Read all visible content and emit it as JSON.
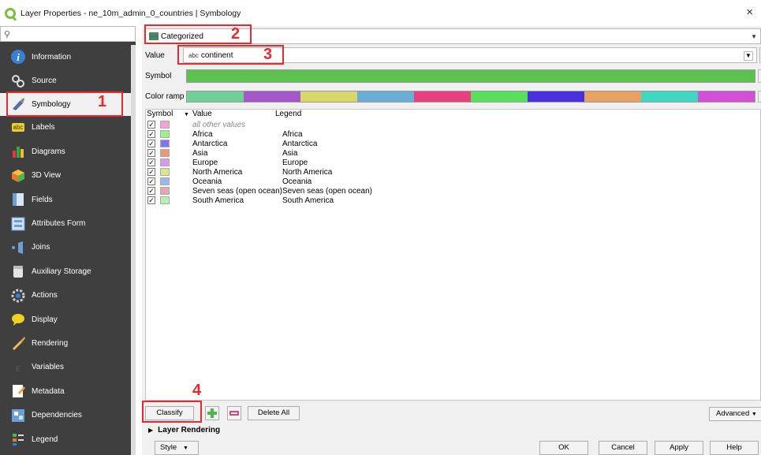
{
  "window": {
    "title": "Layer Properties - ne_10m_admin_0_countries | Symbology",
    "close_glyph": "×"
  },
  "sidebar": {
    "search_placeholder": "",
    "items": [
      {
        "label": "Information",
        "icon": "info-icon"
      },
      {
        "label": "Source",
        "icon": "source-icon"
      },
      {
        "label": "Symbology",
        "icon": "paintbrush-icon"
      },
      {
        "label": "Labels",
        "icon": "labels-icon",
        "icon_text": "abc"
      },
      {
        "label": "Diagrams",
        "icon": "diagram-icon"
      },
      {
        "label": "3D View",
        "icon": "cube-icon"
      },
      {
        "label": "Fields",
        "icon": "fields-icon"
      },
      {
        "label": "Attributes Form",
        "icon": "form-icon"
      },
      {
        "label": "Joins",
        "icon": "joins-icon"
      },
      {
        "label": "Auxiliary Storage",
        "icon": "storage-icon"
      },
      {
        "label": "Actions",
        "icon": "actions-icon"
      },
      {
        "label": "Display",
        "icon": "display-icon"
      },
      {
        "label": "Rendering",
        "icon": "rendering-icon"
      },
      {
        "label": "Variables",
        "icon": "variables-icon"
      },
      {
        "label": "Metadata",
        "icon": "metadata-icon"
      },
      {
        "label": "Dependencies",
        "icon": "dependencies-icon"
      },
      {
        "label": "Legend",
        "icon": "legend-icon"
      }
    ]
  },
  "symbology": {
    "renderer": "Categorized",
    "value_label": "Value",
    "value_prefix": "abc",
    "value_field": "continent",
    "epsilon_glyph": "ε",
    "symbol_label": "Symbol",
    "symbol_color": "#5dc14f",
    "color_ramp_label": "Color ramp",
    "color_ramp": [
      "#6fcf97",
      "#a558c9",
      "#d8d86a",
      "#6aaed6",
      "#e8407f",
      "#58e05c",
      "#4a2fe0",
      "#e8a160",
      "#3fd6c2",
      "#d34fd8"
    ],
    "table": {
      "headers": {
        "symbol": "Symbol",
        "value": "Value",
        "legend": "Legend",
        "sort_glyph": "▼"
      },
      "rows": [
        {
          "checked": "✓",
          "color": "#f2a5d6",
          "value": "all other values",
          "legend": "",
          "other": true
        },
        {
          "checked": "✓",
          "color": "#9ef08a",
          "value": "Africa",
          "legend": "Africa"
        },
        {
          "checked": "✓",
          "color": "#7c77f0",
          "value": "Antarctica",
          "legend": "Antarctica"
        },
        {
          "checked": "✓",
          "color": "#e89a78",
          "value": "Asia",
          "legend": "Asia"
        },
        {
          "checked": "✓",
          "color": "#d79be8",
          "value": "Europe",
          "legend": "Europe"
        },
        {
          "checked": "✓",
          "color": "#dfe68a",
          "value": "North America",
          "legend": "North America"
        },
        {
          "checked": "✓",
          "color": "#9cb8e8",
          "value": "Oceania",
          "legend": "Oceania"
        },
        {
          "checked": "✓",
          "color": "#e8a4b6",
          "value": "Seven seas (open ocean)",
          "legend": "Seven seas (open ocean)"
        },
        {
          "checked": "✓",
          "color": "#b4f0b0",
          "value": "South America",
          "legend": "South America"
        }
      ]
    },
    "classify_label": "Classify",
    "delete_all_label": "Delete All",
    "advanced_label": "Advanced",
    "layer_rendering_label": "Layer Rendering"
  },
  "footer": {
    "style_label": "Style",
    "ok_label": "OK",
    "cancel_label": "Cancel",
    "apply_label": "Apply",
    "help_label": "Help"
  },
  "annotations": [
    "1",
    "2",
    "3",
    "4"
  ],
  "colors": {
    "annotation_red": "#e8292e",
    "sidebar_bg": "#3f3f3f",
    "qgis_green": "#7bbf3b"
  }
}
